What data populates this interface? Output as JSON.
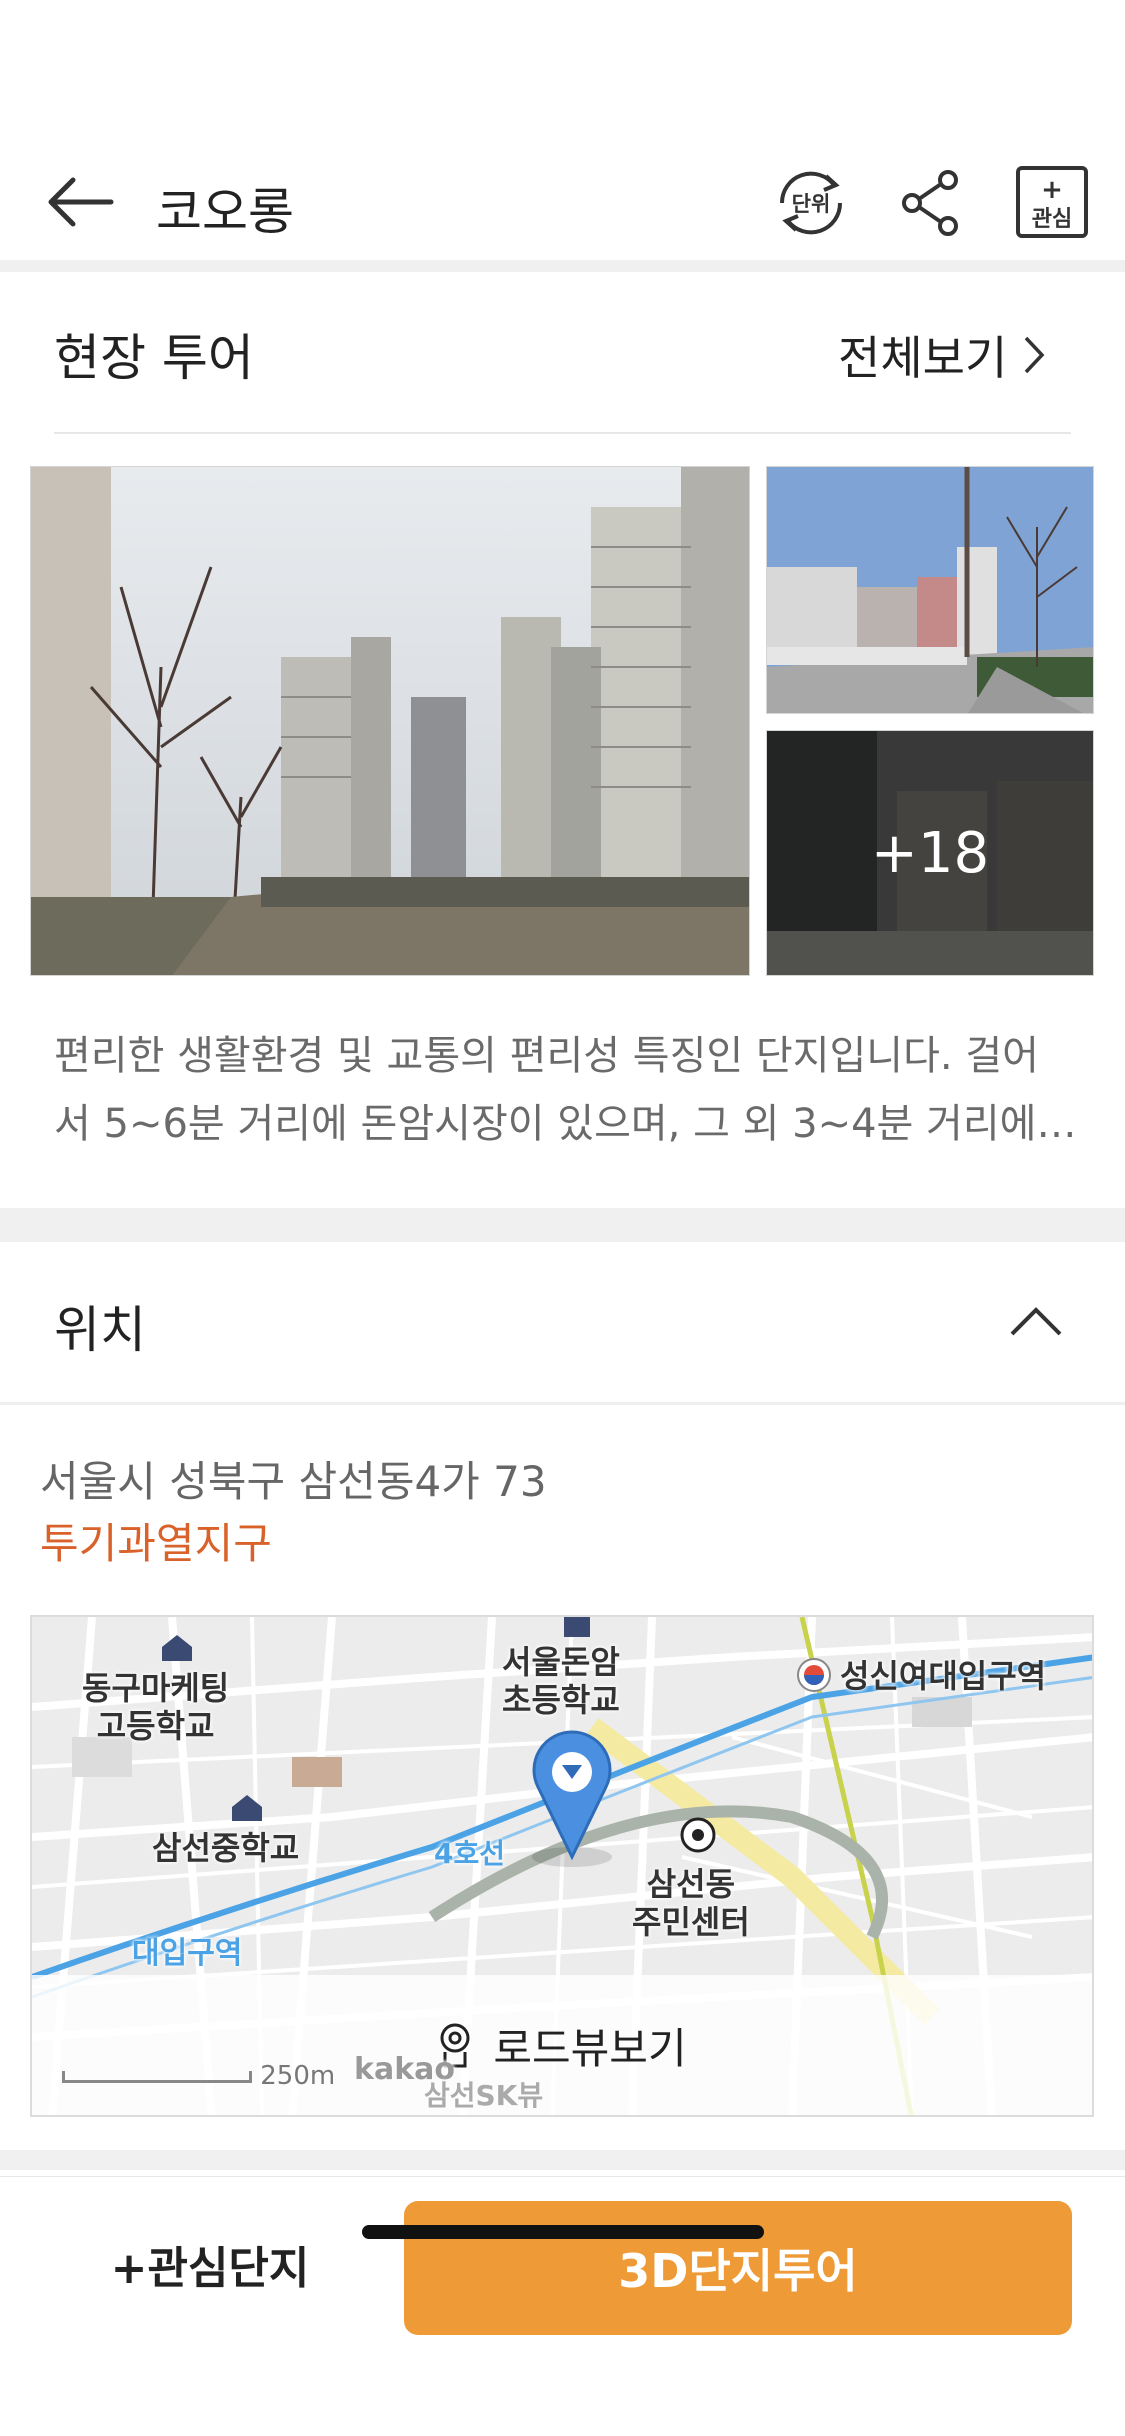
{
  "header": {
    "title": "코오롱",
    "unit_label": "단위",
    "fav_label": "관심",
    "fav_plus": "+"
  },
  "tour": {
    "title": "현장 투어",
    "view_all": "전체보기",
    "more_count": "+18",
    "description": [
      "편리한 생활환경 및 교통의 편리성 특징인 단지입니다. 걸어",
      "서 5~6분 거리에 돈암시장이 있으며, 그 외 3~4분 거리에…"
    ]
  },
  "location": {
    "title": "위치",
    "address": "서울시 성북구 삼선동4가 73",
    "district": "투기과열지구",
    "map": {
      "labels": {
        "school1": "동구마케팅\n고등학교",
        "school2": "서울돈암\n초등학교",
        "station": "성신여대입구역",
        "school3": "삼선중학교",
        "center": "삼선동\n주민센터",
        "line4": "4호선",
        "station_partial": "대입구역",
        "scale": "250m",
        "brand": "kakao",
        "apt": "삼선SK뷰"
      },
      "roadview_label": "로드뷰보기"
    }
  },
  "bottom": {
    "fav_complex": "+관심단지",
    "tour3d": "3D단지투어"
  },
  "colors": {
    "accent": "#ee9a36",
    "district": "#d9622b",
    "pin": "#4a8fe0"
  }
}
